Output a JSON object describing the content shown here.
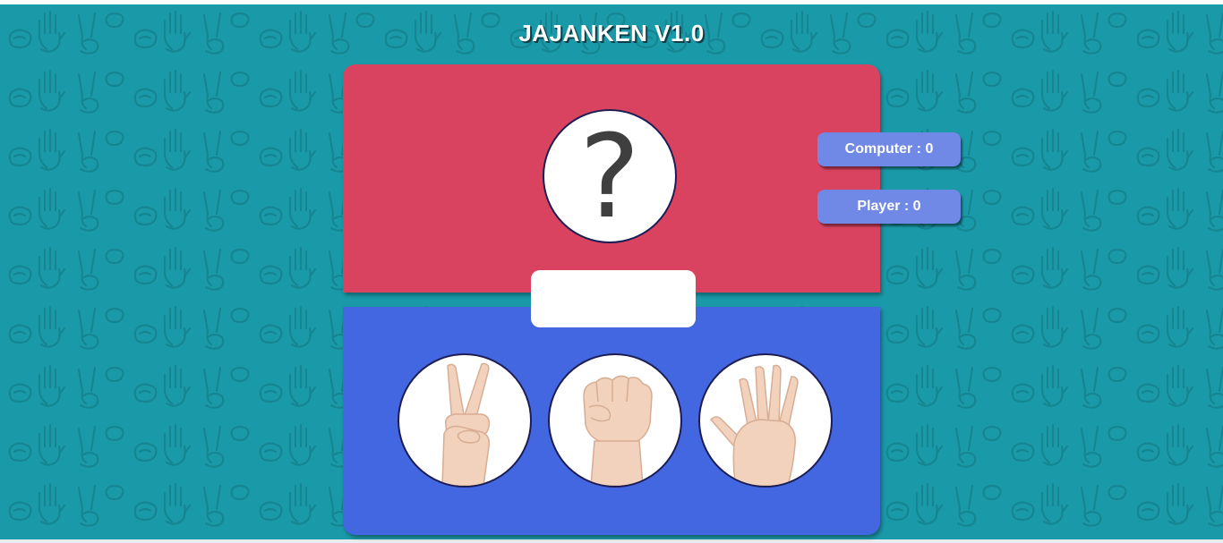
{
  "title": "JAJANKEN V1.0",
  "computer": {
    "choice_symbol": "?",
    "choice_icon": "question-mark-icon"
  },
  "result": {
    "text": ""
  },
  "scores": {
    "computer_label": "Computer",
    "computer_value": "0",
    "player_label": "Player",
    "player_value": "0",
    "separator": " : "
  },
  "choices": [
    {
      "name": "scissors",
      "icon": "scissors-hand-icon"
    },
    {
      "name": "rock",
      "icon": "rock-fist-icon"
    },
    {
      "name": "paper",
      "icon": "paper-open-hand-icon"
    }
  ],
  "colors": {
    "background": "#1a9aa8",
    "computer_panel": "#d94360",
    "player_panel": "#4267e0",
    "score_badge": "#7088e6",
    "circle_border": "#1c1d55"
  }
}
